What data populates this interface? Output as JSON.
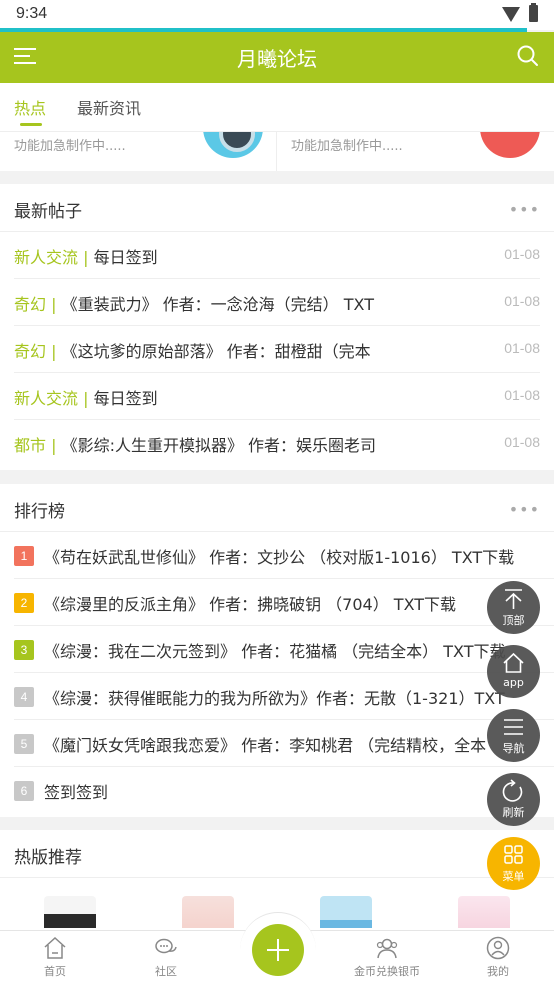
{
  "status": {
    "time": "9:34"
  },
  "header": {
    "title": "月曦论坛"
  },
  "tabs": [
    {
      "label": "热点",
      "active": true
    },
    {
      "label": "最新资讯",
      "active": false
    }
  ],
  "features": {
    "left_text": "功能加急制作中.....",
    "right_text": "功能加急制作中....."
  },
  "latest": {
    "title": "最新帖子",
    "more": "•••",
    "posts": [
      {
        "category": "新人交流",
        "separator": " | ",
        "text": "每日签到",
        "date": "01-08"
      },
      {
        "category": "奇幻",
        "separator": " | ",
        "text": "《重装武力》 作者：一念沧海（完结） TXT",
        "date": "01-08"
      },
      {
        "category": "奇幻",
        "separator": " | ",
        "text": "《这坑爹的原始部落》 作者：甜橙甜（完本",
        "date": "01-08"
      },
      {
        "category": "新人交流",
        "separator": " | ",
        "text": "每日签到",
        "date": "01-08"
      },
      {
        "category": "都市",
        "separator": " | ",
        "text": "《影综:人生重开模拟器》 作者：娱乐圈老司",
        "date": "01-08"
      }
    ]
  },
  "ranking": {
    "title": "排行榜",
    "more": "•••",
    "items": [
      {
        "rank": "1",
        "color": "#f2735d",
        "text": "《苟在妖武乱世修仙》 作者：文抄公 （校对版1-1016） TXT下载"
      },
      {
        "rank": "2",
        "color": "#f7b500",
        "text": "《综漫里的反派主角》 作者：拂晓破钥 （704） TXT下载"
      },
      {
        "rank": "3",
        "color": "#a6c51e",
        "text": "《综漫：我在二次元签到》 作者：花猫橘 （完结全本） TXT下载"
      },
      {
        "rank": "4",
        "color": "#c8c8c8",
        "text": "《综漫：获得催眠能力的我为所欲为》作者：无散（1-321）TXT"
      },
      {
        "rank": "5",
        "color": "#c8c8c8",
        "text": "《魔门妖女凭啥跟我恋爱》 作者：李知桃君 （完结精校，全本"
      },
      {
        "rank": "6",
        "color": "#c8c8c8",
        "text": "签到签到"
      }
    ]
  },
  "hot": {
    "title": "热版推荐"
  },
  "fabs": [
    {
      "label": "顶部",
      "icon": "arrow-up-icon"
    },
    {
      "label": "app",
      "icon": "home-icon"
    },
    {
      "label": "导航",
      "icon": "menu-icon"
    },
    {
      "label": "刷新",
      "icon": "refresh-icon"
    },
    {
      "label": "菜单",
      "icon": "grid-icon"
    }
  ],
  "bottomnav": [
    {
      "label": "首页",
      "icon": "home-icon"
    },
    {
      "label": "社区",
      "icon": "chat-icon"
    },
    {
      "label": "金币兑换银币",
      "icon": "people-icon"
    },
    {
      "label": "我的",
      "icon": "user-icon"
    }
  ],
  "colors": {
    "brand": "#a6c51e",
    "accent": "#20c0c8",
    "fab_yellow": "#f7b500"
  }
}
